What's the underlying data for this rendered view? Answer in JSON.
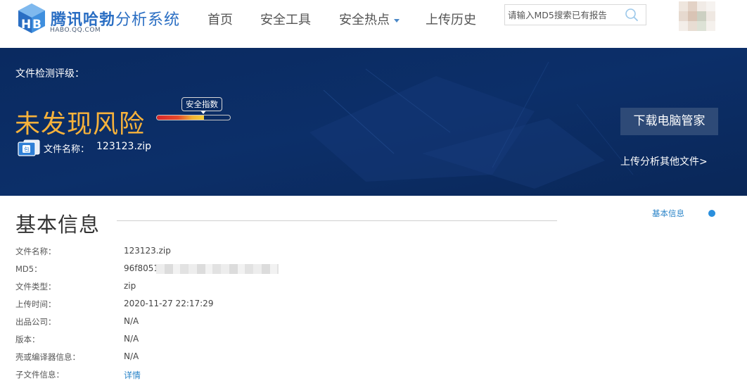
{
  "header": {
    "brand_bold": "腾讯哈勃",
    "brand_light": "分析系统",
    "brand_domain": "HABO.QQ.COM",
    "nav": [
      {
        "label": "首页"
      },
      {
        "label": "安全工具"
      },
      {
        "label": "安全热点",
        "has_dropdown": true
      },
      {
        "label": "上传历史"
      }
    ],
    "search": {
      "placeholder": "请输入MD5搜索已有报告",
      "value": ""
    }
  },
  "banner": {
    "rating_label": "文件检测评级：",
    "verdict": "未发现风险",
    "safety_tag": "安全指数",
    "safety_level": 0.64,
    "file_name_label": "文件名称：",
    "file_name": "123123.zip",
    "download_button": "下载电脑管家",
    "upload_other_link": "上传分析其他文件>"
  },
  "basic_info": {
    "title": "基本信息",
    "side_nav_label": "基本信息",
    "rows": [
      {
        "label": "文件名称：",
        "value": "123123.zip"
      },
      {
        "label": "MD5：",
        "value": "96f8051",
        "redacted": true
      },
      {
        "label": "文件类型：",
        "value": "zip"
      },
      {
        "label": "上传时间：",
        "value": "2020-11-27 22:17:29"
      },
      {
        "label": "出品公司：",
        "value": "N/A"
      },
      {
        "label": "版本：",
        "value": "N/A"
      },
      {
        "label": "壳或编译器信息：",
        "value": "N/A"
      },
      {
        "label": "子文件信息：",
        "value": "详情",
        "is_link": true
      }
    ]
  },
  "colors": {
    "brand_blue": "#2a6ec3",
    "banner_bg": "#0b2c63",
    "verdict_orange": "#f7b23b",
    "link_blue": "#2a84c8"
  },
  "icons": [
    "habo-logo-icon",
    "search-icon",
    "dropdown-caret-icon",
    "file-package-icon",
    "nav-dot-icon"
  ]
}
